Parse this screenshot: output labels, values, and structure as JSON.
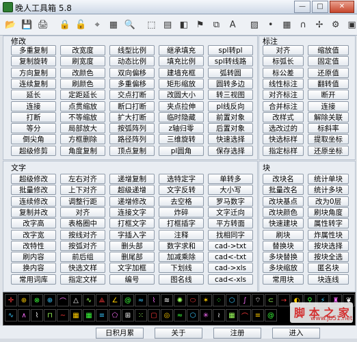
{
  "window": {
    "title": "晚人工具箱 5.8"
  },
  "toolbar_icons": [
    "open-folder-icon",
    "save-icon",
    "print-icon",
    "lock-icon",
    "unlock-icon",
    "dimension-icon",
    "grid-icon",
    "search-icon",
    "select-icon",
    "layer-icon",
    "color-icon",
    "flag-icon",
    "copy-icon",
    "text-style-icon",
    "hatch-icon",
    "point-icon",
    "table-icon",
    "magnet-icon",
    "snap-icon",
    "settings-icon",
    "calculator-icon"
  ],
  "sections": {
    "modify": {
      "label": "修改",
      "rows": [
        [
          "多重复制",
          "改宽度",
          "线型比例",
          "继承填充",
          "spl转pl"
        ],
        [
          "复制旋转",
          "刷宽度",
          "动态比例",
          "填充比例",
          "spl转线路"
        ],
        [
          "方向复制",
          "改颜色",
          "双向偏移",
          "建墙充框",
          "弧转圆"
        ],
        [
          "连续复制",
          "刷颜色",
          "多重偏移",
          "矩形缩放",
          "圆转多边"
        ],
        [
          "延长",
          "定距延长",
          "交点打断",
          "改圆大小",
          "转三视图"
        ],
        [
          "连接",
          "点贯缩放",
          "断口打断",
          "夹点拉伸",
          "pl线反向"
        ],
        [
          "打断",
          "不等缩放",
          "扩大打断",
          "临时隐藏",
          "前置对象"
        ],
        [
          "等分",
          "局部放大",
          "按弧阵列",
          "z轴归零",
          "后置对象"
        ],
        [
          "倒尖角",
          "方框删除",
          "路径阵列",
          "三维旋转",
          "快速选择"
        ],
        [
          "超级修剪",
          "角度复制",
          "顶点复制",
          "pl圆角",
          "保存选择"
        ]
      ]
    },
    "annotate": {
      "label": "标注",
      "rows": [
        [
          "对齐",
          "缩放值"
        ],
        [
          "标弧长",
          "固定值"
        ],
        [
          "标公差",
          "还原值"
        ],
        [
          "线性标注",
          "翻转值"
        ],
        [
          "对齐标注",
          "断开"
        ],
        [
          "合并标注",
          "连接"
        ],
        [
          "改样式",
          "解除关联"
        ],
        [
          "选改过的",
          "标斜率"
        ],
        [
          "快选标样",
          "提取坐标"
        ],
        [
          "指定标样",
          "还原坐标"
        ]
      ]
    },
    "text": {
      "label": "文字",
      "rows": [
        [
          "超级修改",
          "左右对齐",
          "递增复制",
          "选特定字",
          "单转多"
        ],
        [
          "批量修改",
          "上下对齐",
          "超级递增",
          "文字反转",
          "大小写"
        ],
        [
          "连续修改",
          "调整行距",
          "递增修改",
          "去空格",
          "罗马数字"
        ],
        [
          "复制并改",
          "对齐",
          "连接文字",
          "炸碎",
          "文字迁向"
        ],
        [
          "改字高",
          "表格圈中",
          "打框文字",
          "打框插字",
          "平方转面"
        ],
        [
          "改字宽",
          "按线对齐",
          "字插入字",
          "注释",
          "找相同字"
        ],
        [
          "改特性",
          "按弧对齐",
          "删头部",
          "数字求和",
          "cad->txt"
        ],
        [
          "刷内容",
          "前后组",
          "删尾部",
          "加减乘除",
          "cad<-txt"
        ],
        [
          "换内容",
          "快选文样",
          "文字加框",
          "下划线",
          "cad->xls"
        ],
        [
          "常用词库",
          "指定文样",
          "编号",
          "图名线",
          "cad<-xls"
        ]
      ]
    },
    "block": {
      "label": "块",
      "rows": [
        [
          "改块名",
          "统计单块"
        ],
        [
          "批量改名",
          "统计多块"
        ],
        [
          "改块基点",
          "改为0层"
        ],
        [
          "改块颜色",
          "刷块角度"
        ],
        [
          "快速建块",
          "属性转字"
        ],
        [
          "刷块",
          "炸属性块"
        ],
        [
          "替换块",
          "按块选择"
        ],
        [
          "多块替换",
          "按块全选"
        ],
        [
          "多块缩放",
          "匿名块"
        ],
        [
          "常用块",
          "块连线"
        ]
      ]
    }
  },
  "icon_strip": {
    "row1": [
      "red-crosshair-icon",
      "circle-target-icon",
      "circle-cross-icon",
      "circle-plus-icon",
      "arc-icon",
      "triangle-icon",
      "curve-icon",
      "pyramid-icon",
      "angle-icon",
      "spiral-icon",
      "wave-icon",
      "polyline-icon",
      "zigzag-icon",
      "gear-icon",
      "ellipse-icon",
      "star-icon",
      "grid-dots-icon",
      "cube-icon",
      "spring-icon",
      "fan-icon",
      "pipe-icon",
      "arrow-line-icon",
      "half-moon-icon",
      "pin-icon",
      "bolt-icon",
      "tower-icon",
      "leaf-icon"
    ],
    "row2": [
      "spring-wave-icon",
      "triangle-wave-icon",
      "coil-icon",
      "square-wave-icon",
      "sine-icon",
      "mesh-icon",
      "grid-icon",
      "stripes-icon",
      "polygon-icon",
      "cross-hatch-icon",
      "dots-icon",
      "box-icon",
      "rings-icon",
      "wiggle-icon",
      "hexagon-icon",
      "sparkle-icon",
      "zigzag-green-icon",
      "box-grid-icon",
      "arc-blue-icon",
      "lines-icon",
      "spiral-green-icon"
    ],
    "colors": [
      "#ff3b3b",
      "#ffcc00",
      "#3cff3c",
      "#3cc8ff",
      "#ff70ff",
      "#ffffff",
      "#9cff5c"
    ]
  },
  "bottom_buttons": [
    "日积月累",
    "关于",
    "注册",
    "进入"
  ],
  "watermark": {
    "text": "脚 本 之 家",
    "url": "www.jb51.net"
  }
}
